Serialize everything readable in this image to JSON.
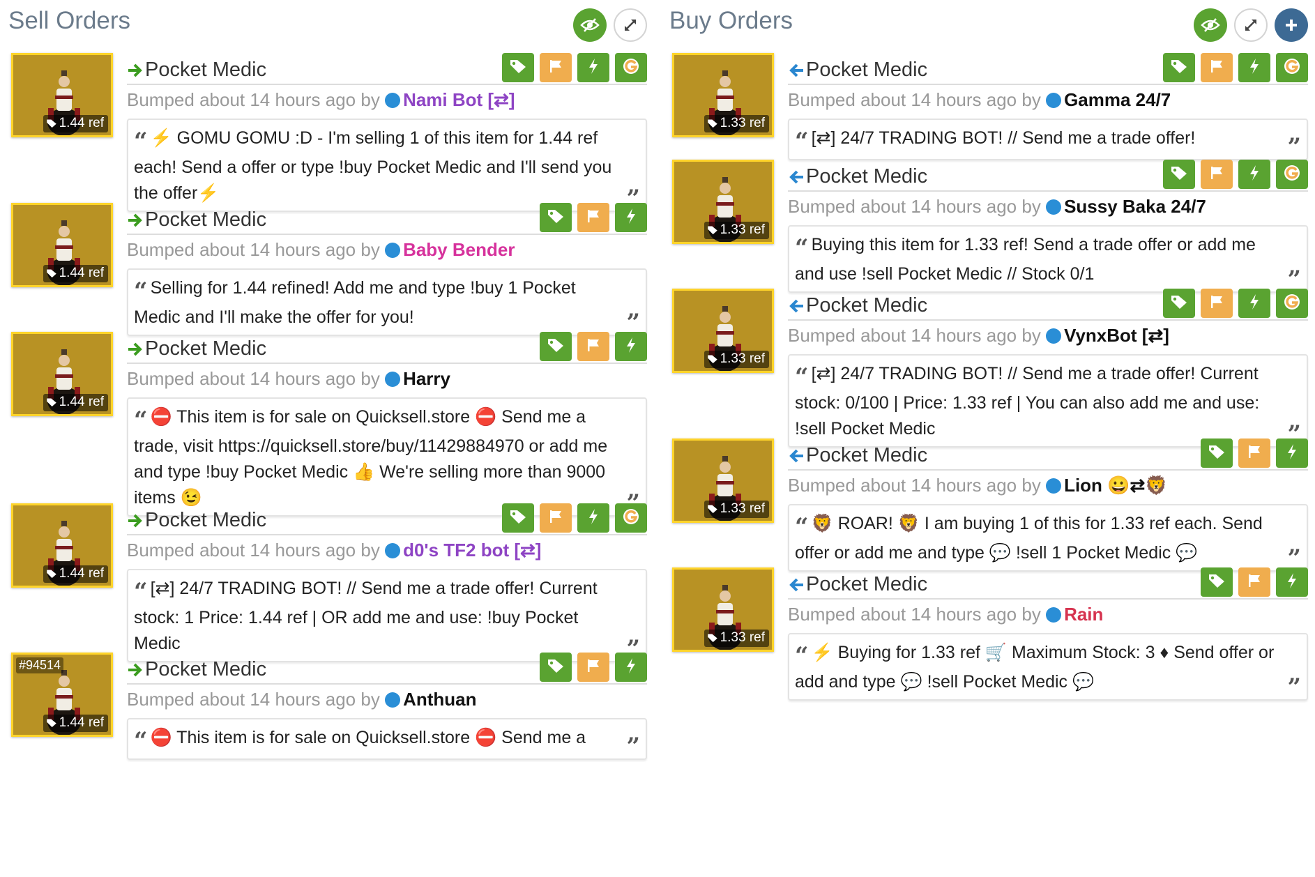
{
  "sell": {
    "title": "Sell Orders",
    "listings": [
      {
        "name": "Pocket Medic",
        "price": "1.44 ref",
        "bumped": "Bumped about 14 hours ago by",
        "user": "Nami Bot [⇄]",
        "user_color": "#8e44c4",
        "message": "⚡ GOMU GOMU :D - I'm selling 1 of this item for 1.44 ref each! Send a offer or type !buy Pocket Medic and I'll send you the offer⚡",
        "tags": [
          "price-tag-icon",
          "flag-icon",
          "bolt-icon",
          "g-icon"
        ]
      },
      {
        "name": "Pocket Medic",
        "price": "1.44 ref",
        "bumped": "Bumped about 14 hours ago by",
        "user": "Baby Bender",
        "user_color": "#d6329c",
        "message": "Selling for 1.44 refined! Add me and type !buy 1 Pocket Medic and I'll make the offer for you!",
        "tags": [
          "price-tag-icon",
          "flag-icon",
          "bolt-icon"
        ]
      },
      {
        "name": "Pocket Medic",
        "price": "1.44 ref",
        "bumped": "Bumped about 14 hours ago by",
        "user": "Harry",
        "user_color": "#111111",
        "message": "⛔ This item is for sale on Quicksell.store ⛔ Send me a trade, visit https://quicksell.store/buy/11429884970 or add me and type !buy Pocket Medic 👍 We're selling more than 9000 items 😉",
        "tags": [
          "price-tag-icon",
          "flag-icon",
          "bolt-icon"
        ]
      },
      {
        "name": "Pocket Medic",
        "price": "1.44 ref",
        "bumped": "Bumped about 14 hours ago by",
        "user": "d0's TF2 bot [⇄]",
        "user_color": "#8e44c4",
        "message": "[⇄] 24/7 TRADING BOT! // Send me a trade offer! Current stock: 1 Price: 1.44 ref | OR add me and use: !buy Pocket Medic",
        "tags": [
          "price-tag-icon",
          "flag-icon",
          "bolt-icon",
          "g-icon"
        ]
      },
      {
        "name": "Pocket Medic",
        "price": "1.44 ref",
        "id": "#94514",
        "bumped": "Bumped about 14 hours ago by",
        "user": "Anthuan",
        "user_color": "#111111",
        "message": "⛔ This item is for sale on Quicksell.store ⛔ Send me a",
        "tags": [
          "price-tag-icon",
          "flag-icon",
          "bolt-icon"
        ]
      }
    ]
  },
  "buy": {
    "title": "Buy Orders",
    "listings": [
      {
        "name": "Pocket Medic",
        "price": "1.33 ref",
        "bumped": "Bumped about 14 hours ago by",
        "user": "Gamma 24/7",
        "user_color": "#111111",
        "message": "[⇄] 24/7 TRADING BOT! // Send me a trade offer!",
        "tags": [
          "price-tag-icon",
          "flag-icon",
          "bolt-icon",
          "g-icon"
        ]
      },
      {
        "name": "Pocket Medic",
        "price": "1.33 ref",
        "bumped": "Bumped about 14 hours ago by",
        "user": "Sussy Baka 24/7",
        "user_color": "#111111",
        "message": "Buying this item for 1.33 ref! Send a trade offer or add me and use !sell Pocket Medic // Stock 0/1",
        "tags": [
          "price-tag-icon",
          "flag-icon",
          "bolt-icon",
          "g-icon"
        ]
      },
      {
        "name": "Pocket Medic",
        "price": "1.33 ref",
        "bumped": "Bumped about 14 hours ago by",
        "user": "VynxBot [⇄]",
        "user_color": "#111111",
        "message": "[⇄] 24/7 TRADING BOT! // Send me a trade offer! Current stock: 0/100 | Price: 1.33 ref | You can also add me and use: !sell Pocket Medic",
        "tags": [
          "price-tag-icon",
          "flag-icon",
          "bolt-icon",
          "g-icon"
        ]
      },
      {
        "name": "Pocket Medic",
        "price": "1.33 ref",
        "bumped": "Bumped about 14 hours ago by",
        "user": "Lion 😀⇄🦁",
        "user_color": "#111111",
        "message": "🦁 ROAR! 🦁 I am buying 1 of this for 1.33 ref each. Send offer or add me and type 💬 !sell 1 Pocket Medic 💬",
        "tags": [
          "price-tag-icon",
          "flag-icon",
          "bolt-icon"
        ]
      },
      {
        "name": "Pocket Medic",
        "price": "1.33 ref",
        "bumped": "Bumped about 14 hours ago by",
        "user": "Rain",
        "user_color": "#d6334f",
        "message": "⚡ Buying for 1.33 ref 🛒 Maximum Stock: 3 ♦ Send offer or add and type 💬 !sell Pocket Medic 💬",
        "tags": [
          "price-tag-icon",
          "flag-icon",
          "bolt-icon"
        ]
      }
    ]
  }
}
